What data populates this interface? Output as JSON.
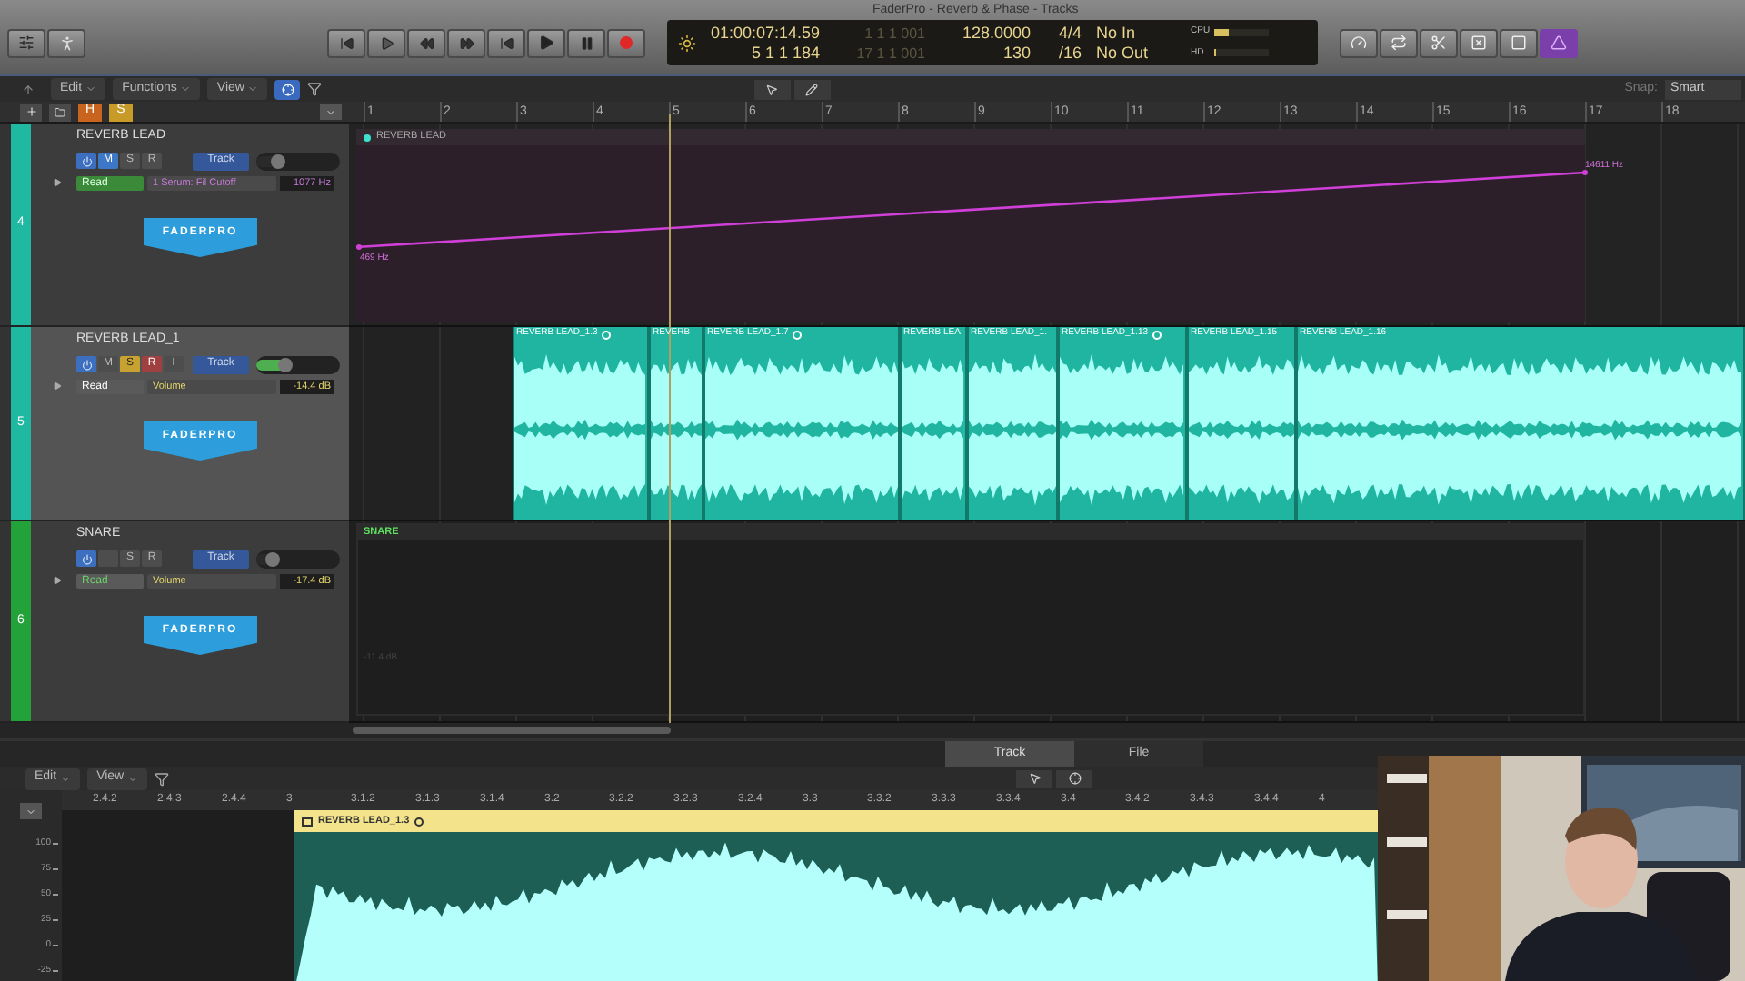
{
  "window": {
    "title": "FaderPro - Reverb & Phase - Tracks"
  },
  "lcd": {
    "time": "01:00:07:14.59",
    "bars": "5 1 1 184",
    "locator_start": "1 1 1 001",
    "locator_end": "17 1 1 001",
    "tempo": "128.0000",
    "tempo_alt": "130",
    "signature": "4/4",
    "division": "/16",
    "input": "No In",
    "output": "No Out",
    "cpu_label": "CPU",
    "hd_label": "HD",
    "cpu": {
      "level": 0.25
    },
    "hd": {
      "level": 0.02
    }
  },
  "toolbar": {
    "menus": [
      "Edit",
      "Functions",
      "View"
    ],
    "snap_label": "Snap:",
    "snap_value": "Smart"
  },
  "header_buttons": [
    {
      "label": "H",
      "color": "#c8641e"
    },
    {
      "label": "S",
      "color": "#c89a28"
    }
  ],
  "ruler": [
    "1",
    "2",
    "3",
    "4",
    "5",
    "6",
    "7",
    "8",
    "9",
    "10",
    "11",
    "12",
    "13",
    "14",
    "15",
    "16",
    "17",
    "18"
  ],
  "tracks": [
    {
      "number": "4",
      "color": "#1fb9a2",
      "name": "REVERB LEAD",
      "selected": false,
      "buttons": [
        {
          "kind": "mute",
          "label": "M",
          "on": true
        },
        {
          "kind": "solo",
          "label": "S",
          "on": false
        },
        {
          "kind": "record",
          "label": "R",
          "on": false
        }
      ],
      "track_button": "Track",
      "fader": {
        "level": 0.25
      },
      "mode": {
        "label": "Read",
        "filled": true,
        "color": "#3a8a3a"
      },
      "parameter": {
        "label": "1 Serum: Fil Cutoff",
        "color": "#c57ad8"
      },
      "value": "1077 Hz",
      "logo": "FADERPRO",
      "lane": {
        "kind": "automation",
        "region": "REVERB LEAD",
        "start_label": "469 Hz",
        "end_label": "14611 Hz"
      }
    },
    {
      "number": "5",
      "color": "#1fb9a2",
      "name": "REVERB LEAD_1",
      "selected": true,
      "buttons": [
        {
          "kind": "mute",
          "label": "M",
          "on": false
        },
        {
          "kind": "solo",
          "label": "S",
          "on": true
        },
        {
          "kind": "record",
          "label": "R",
          "on": true
        },
        {
          "kind": "input",
          "label": "I",
          "on": false
        }
      ],
      "track_button": "Track",
      "fader": {
        "level": 0.35
      },
      "mode": {
        "label": "Read",
        "filled": false,
        "color": "#ffffff"
      },
      "parameter": {
        "label": "Volume",
        "color": "#e2d56a"
      },
      "value": "-14.4 dB",
      "logo": "FADERPRO",
      "lane": {
        "kind": "audio",
        "regions": [
          "REVERB LEAD_1.3",
          "REVERB",
          "REVERB LEAD_1.7",
          "REVERB LEA",
          "REVERB LEAD_1.",
          "REVERB LEAD_1.13",
          "REVERB LEAD_1.15",
          "REVERB LEAD_1.16"
        ]
      }
    },
    {
      "number": "6",
      "color": "#24a23a",
      "name": "SNARE",
      "selected": false,
      "buttons": [
        {
          "kind": "blank",
          "on": false
        },
        {
          "kind": "solo",
          "label": "S",
          "on": false
        },
        {
          "kind": "record",
          "label": "R",
          "on": false
        }
      ],
      "track_button": "Track",
      "fader": {
        "level": 0.2
      },
      "mode": {
        "label": "Read",
        "filled": false,
        "color": "#6ad46a"
      },
      "parameter": {
        "label": "Volume",
        "color": "#e2d56a"
      },
      "value": "-17.4 dB",
      "logo": "FADERPRO",
      "lane": {
        "kind": "empty",
        "region": "SNARE",
        "value_label": "-11.4 dB"
      }
    }
  ],
  "editor": {
    "tabs": [
      {
        "label": "Track",
        "selected": true
      },
      {
        "label": "File",
        "selected": false
      }
    ],
    "menus": [
      "Edit",
      "View"
    ],
    "ruler": [
      "2.4.2",
      "2.4.3",
      "2.4.4",
      "3",
      "3.1.2",
      "3.1.3",
      "3.1.4",
      "3.2",
      "3.2.2",
      "3.2.3",
      "3.2.4",
      "3.3",
      "3.3.2",
      "3.3.3",
      "3.3.4",
      "3.4",
      "3.4.2",
      "3.4.3",
      "3.4.4",
      "4"
    ],
    "region": "REVERB LEAD_1.3",
    "y_scale": [
      "100",
      "75",
      "50",
      "25",
      "0",
      "-25"
    ]
  }
}
